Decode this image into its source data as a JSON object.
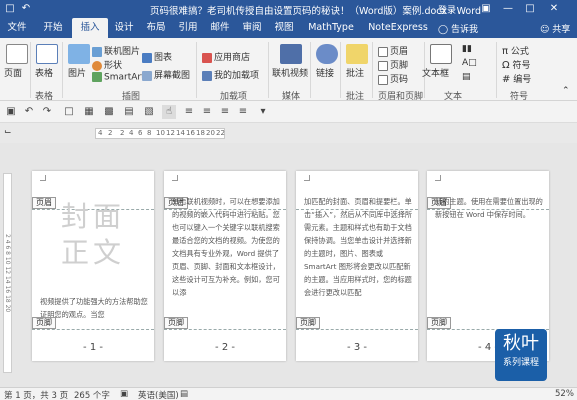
{
  "titlebar": {
    "title": "页码很难搞？老司机传授自由设置页码的秘诀！（Word版）案例.docx - Word",
    "login": "登录"
  },
  "tabs": [
    "文件",
    "开始",
    "插入",
    "设计",
    "布局",
    "引用",
    "邮件",
    "审阅",
    "视图",
    "MathType",
    "NoteExpress"
  ],
  "active_tab": "插入",
  "tell_me": "告诉我",
  "share": "共享",
  "ribbon": {
    "page": "页面",
    "table": "表格",
    "picture": "图片",
    "online_picture": "联机图片",
    "shapes": "形状",
    "smartart": "SmartArt",
    "chart": "图表",
    "screenshot": "屏幕截图",
    "store": "应用商店",
    "my_addins": "我的加载项",
    "online_video": "联机视频",
    "link": "链接",
    "comment": "批注",
    "header": "页眉",
    "footer": "页脚",
    "page_number": "页码",
    "textbox": "文本框",
    "formula": "公式",
    "symbol": "符号",
    "numbering": "编号",
    "groups": {
      "table": "表格",
      "illustrations": "插图",
      "addins": "加载项",
      "media": "媒体",
      "comments": "批注",
      "header_footer": "页眉和页脚",
      "text": "文本",
      "symbols": "符号"
    }
  },
  "ruler_ticks": [
    "4",
    "2",
    "2",
    "4",
    "6",
    "8",
    "10",
    "12",
    "14",
    "16",
    "18",
    "20",
    "22"
  ],
  "pages": [
    {
      "header_tag": "页眉",
      "footer_tag": "页脚",
      "cover_line1": "封面",
      "cover_line2": "正文",
      "text": "视频提供了功能强大的方法帮助您证明您的观点。当您",
      "page_number": "- 1 -"
    },
    {
      "header_tag": "页眉",
      "footer_tag": "页脚",
      "text": "单击联机视频时，可以在想要添加的视频的嵌入代码中进行粘贴。您也可以键入一个关键字以联机搜索最适合您的文档的视频。为使您的文档具有专业外观，Word 提供了页眉、页脚、封面和文本框设计，这些设计可互为补充。例如，您可以添",
      "page_number": "- 2 -"
    },
    {
      "header_tag": "页眉",
      "footer_tag": "页脚",
      "text": "加匹配的封面、页眉和提要栏。单击“插入”，然后从不同库中选择所需元素。主题和样式也有助于文档保持协调。当您单击设计并选择新的主题时，图片、图表或 SmartArt 图形将会更改以匹配新的主题。当应用样式时，您的标题会进行更改以匹配",
      "page_number": "- 3 -"
    },
    {
      "header_tag": "页眉",
      "footer_tag": "页脚",
      "text": "新的主题。使用在需要位置出现的新按钮在 Word 中保存时间。",
      "page_number": "- 4 -"
    }
  ],
  "statusbar": {
    "page_info": "第 1 页，共 3 页",
    "word_count": "265 个字",
    "language": "英语(美国)",
    "zoom": "52%"
  },
  "logo": {
    "line1": "秋叶",
    "line2": "系列课程"
  }
}
